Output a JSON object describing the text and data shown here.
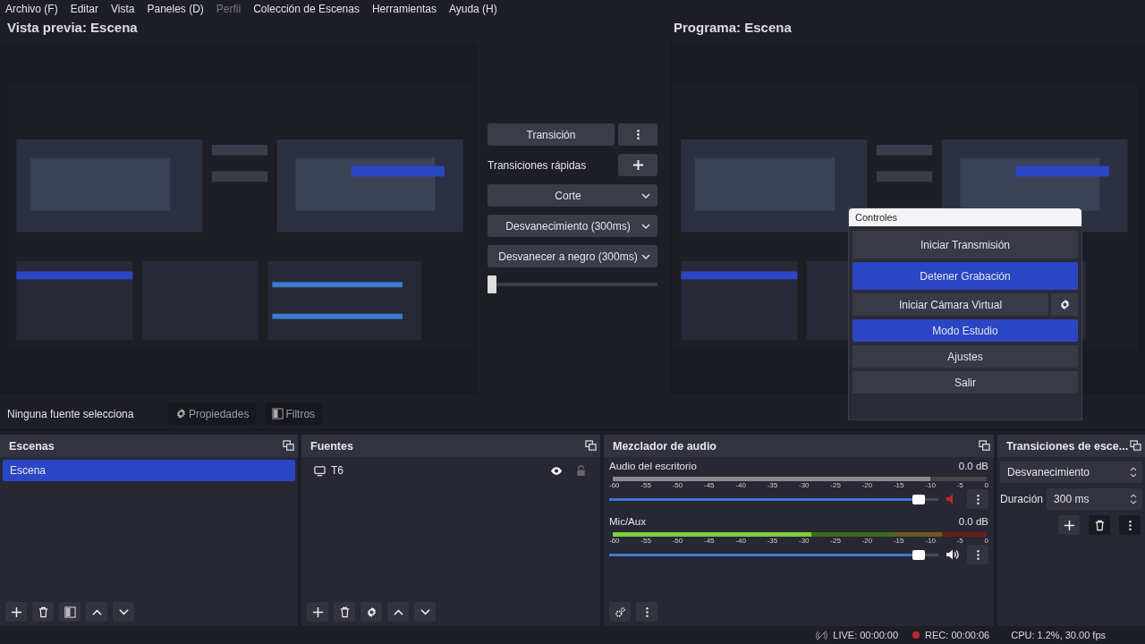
{
  "menu": [
    {
      "label": "Archivo (F)",
      "disabled": false
    },
    {
      "label": "Editar",
      "disabled": false
    },
    {
      "label": "Vista",
      "disabled": false
    },
    {
      "label": "Paneles (D)",
      "disabled": false
    },
    {
      "label": "Perfil",
      "disabled": true
    },
    {
      "label": "Colección de Escenas",
      "disabled": false
    },
    {
      "label": "Herramientas",
      "disabled": false
    },
    {
      "label": "Ayuda (H)",
      "disabled": false
    }
  ],
  "preview": {
    "title": "Vista previa: Escena",
    "kind": "picture"
  },
  "program": {
    "title": "Programa: Escena",
    "kind": "picture"
  },
  "transition_panel": {
    "button": "Transición",
    "quick_label": "Transiciones rápidas",
    "quick": [
      "Corte",
      "Desvanecimiento (300ms)",
      "Desvanecer a negro (300ms)"
    ],
    "tbar": {
      "level": 0
    }
  },
  "controls": {
    "title": "Controles",
    "buttons": [
      {
        "label": "Iniciar Transmisión",
        "active": false,
        "settings": false
      },
      {
        "label": "Detener Grabación",
        "active": true,
        "settings": false
      },
      {
        "label": "Iniciar Cámara Virtual",
        "active": false,
        "settings": true
      },
      {
        "label": "Modo Estudio",
        "active": true,
        "settings": false
      },
      {
        "label": "Ajustes",
        "active": false,
        "settings": false
      },
      {
        "label": "Salir",
        "active": false,
        "settings": false
      }
    ]
  },
  "source_bar": {
    "status": "Ninguna fuente selecciona",
    "properties": "Propiedades",
    "filters": "Filtros"
  },
  "scenes": {
    "title": "Escenas",
    "items": [
      {
        "label": "Escena",
        "selected": true
      }
    ]
  },
  "sources": {
    "title": "Fuentes",
    "items": [
      {
        "label": "T6",
        "visible": true,
        "locked": false
      }
    ]
  },
  "mixer": {
    "title": "Mezclador de audio",
    "channels": [
      {
        "name": "Audio del escritorio",
        "reading": "0.0 dB",
        "muted": true,
        "meter": {
          "level": 0.85
        },
        "volume": {
          "level": 0.96
        },
        "scale": [
          "-60",
          "-55",
          "-50",
          "-45",
          "-40",
          "-35",
          "-30",
          "-25",
          "-20",
          "-15",
          "-10",
          "-5",
          "0"
        ]
      },
      {
        "name": "Mic/Aux",
        "reading": "0.0 dB",
        "muted": false,
        "meter": {
          "level": 0.53
        },
        "volume": {
          "level": 0.96
        },
        "scale": [
          "-60",
          "-55",
          "-50",
          "-45",
          "-40",
          "-35",
          "-30",
          "-25",
          "-20",
          "-15",
          "-10",
          "-5",
          "0"
        ]
      }
    ]
  },
  "scene_transitions": {
    "title": "Transiciones de esce...",
    "type": "Desvanecimiento",
    "duration_label": "Duración",
    "duration": "300 ms"
  },
  "status_bar": {
    "live": "LIVE: 00:00:00",
    "recording": true,
    "rec": "REC: 00:00:06",
    "cpu": "CPU: 1.2%, 30.00 fps"
  }
}
